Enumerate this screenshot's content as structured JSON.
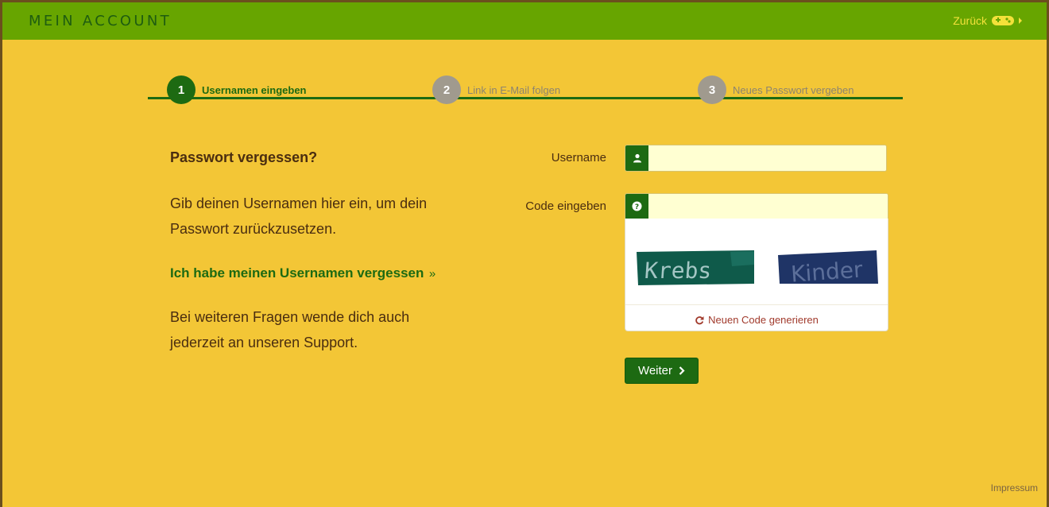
{
  "header": {
    "title": "MEIN ACCOUNT",
    "back_label": "Zurück",
    "back_icon": "gamepad-icon"
  },
  "steps": [
    {
      "number": "1",
      "label": "Usernamen eingeben",
      "state": "active"
    },
    {
      "number": "2",
      "label": "Link in E-Mail folgen",
      "state": "inactive"
    },
    {
      "number": "3",
      "label": "Neues Passwort vergeben",
      "state": "inactive"
    }
  ],
  "info": {
    "title": "Passwort vergessen?",
    "description": "Gib deinen Usernamen hier ein, um dein Passwort zurückzusetzen.",
    "forgot_link": "Ich habe meinen Usernamen vergessen",
    "forgot_link_suffix": "»",
    "support_text": "Bei weiteren Fragen wende dich auch jederzeit an unseren Support."
  },
  "form": {
    "username_label": "Username",
    "username_value": "",
    "username_icon": "user-icon",
    "code_label": "Code eingeben",
    "code_value": "",
    "code_icon": "question-icon",
    "captcha_words": [
      "Krebs",
      "Kinder"
    ],
    "regen_label": "Neuen Code generieren",
    "regen_icon": "refresh-icon",
    "submit_label": "Weiter",
    "submit_icon": "chevron-right-icon"
  },
  "footer": {
    "impressum": "Impressum"
  },
  "colors": {
    "header_bg": "#67a500",
    "page_bg": "#f3c636",
    "accent_green": "#1d6a12",
    "text_brown": "#4a2d10",
    "input_bg": "#ffffd2",
    "link_red": "#a13a2c"
  }
}
